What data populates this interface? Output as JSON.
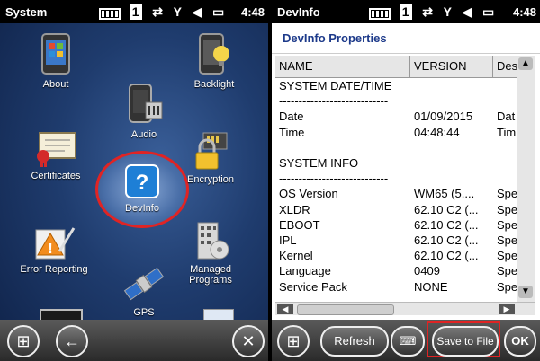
{
  "left": {
    "status_title": "System",
    "time": "4:48",
    "badge": "1",
    "apps": [
      {
        "label": "About"
      },
      {
        "label": "Backlight"
      },
      {
        "label": "Audio"
      },
      {
        "label": "Certificates"
      },
      {
        "label": "DevInfo"
      },
      {
        "label": "Encryption"
      },
      {
        "label": "Error Reporting"
      },
      {
        "label": "Managed Programs"
      },
      {
        "label": "GPS"
      }
    ]
  },
  "right": {
    "status_title": "DevInfo",
    "time": "4:48",
    "badge": "1",
    "title": "DevInfo Properties",
    "columns": [
      "NAME",
      "VERSION",
      "Des"
    ],
    "rows": [
      {
        "name": "SYSTEM DATE/TIME",
        "version": "",
        "desc": ""
      },
      {
        "name": "----------------------------",
        "version": "",
        "desc": ""
      },
      {
        "name": "Date",
        "version": "01/09/2015",
        "desc": "Dat"
      },
      {
        "name": "Time",
        "version": "04:48:44",
        "desc": "Tim"
      },
      {
        "name": "",
        "version": "",
        "desc": ""
      },
      {
        "name": "SYSTEM INFO",
        "version": "",
        "desc": ""
      },
      {
        "name": "----------------------------",
        "version": "",
        "desc": ""
      },
      {
        "name": "OS Version",
        "version": "WM65 (5....",
        "desc": "Spe"
      },
      {
        "name": "XLDR",
        "version": "62.10 C2 (...",
        "desc": "Spe"
      },
      {
        "name": "EBOOT",
        "version": "62.10 C2 (...",
        "desc": "Spe"
      },
      {
        "name": "IPL",
        "version": "62.10 C2 (...",
        "desc": "Spe"
      },
      {
        "name": "Kernel",
        "version": "62.10 C2 (...",
        "desc": "Spe"
      },
      {
        "name": "Language",
        "version": "0409",
        "desc": "Spe"
      },
      {
        "name": "Service Pack",
        "version": "NONE",
        "desc": "Spe"
      }
    ],
    "buttons": {
      "refresh": "Refresh",
      "save": "Save to File",
      "ok": "OK"
    }
  }
}
